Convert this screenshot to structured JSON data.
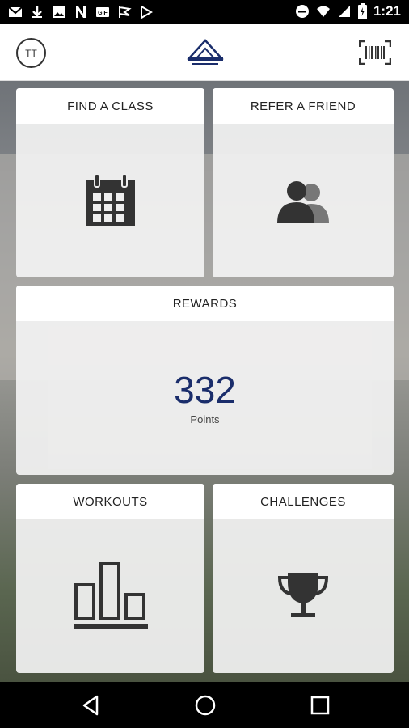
{
  "status_bar": {
    "time": "1:21",
    "left_icons": [
      "gmail-icon",
      "download-icon",
      "photo-icon",
      "n-app-icon",
      "gif-icon",
      "flag-icon",
      "play-store-icon"
    ],
    "right_icons": [
      "do-not-disturb-icon",
      "wifi-icon",
      "cellular-icon",
      "battery-icon"
    ]
  },
  "app_bar": {
    "avatar_initials": "TT",
    "logo_icon": "club-logo-icon",
    "barcode_icon": "barcode-icon"
  },
  "tiles": {
    "find_class": {
      "label": "FIND A CLASS",
      "icon": "calendar-icon"
    },
    "refer_friend": {
      "label": "REFER A FRIEND",
      "icon": "users-icon"
    },
    "rewards": {
      "label": "REWARDS",
      "points": "332",
      "points_label": "Points"
    },
    "workouts": {
      "label": "WORKOUTS",
      "icon": "bar-chart-icon"
    },
    "challenges": {
      "label": "CHALLENGES",
      "icon": "trophy-icon"
    }
  },
  "colors": {
    "points": "#1a2d6b",
    "icon": "#333333"
  },
  "nav_bar": {
    "icons": [
      "back-icon",
      "home-icon",
      "recents-icon"
    ]
  }
}
